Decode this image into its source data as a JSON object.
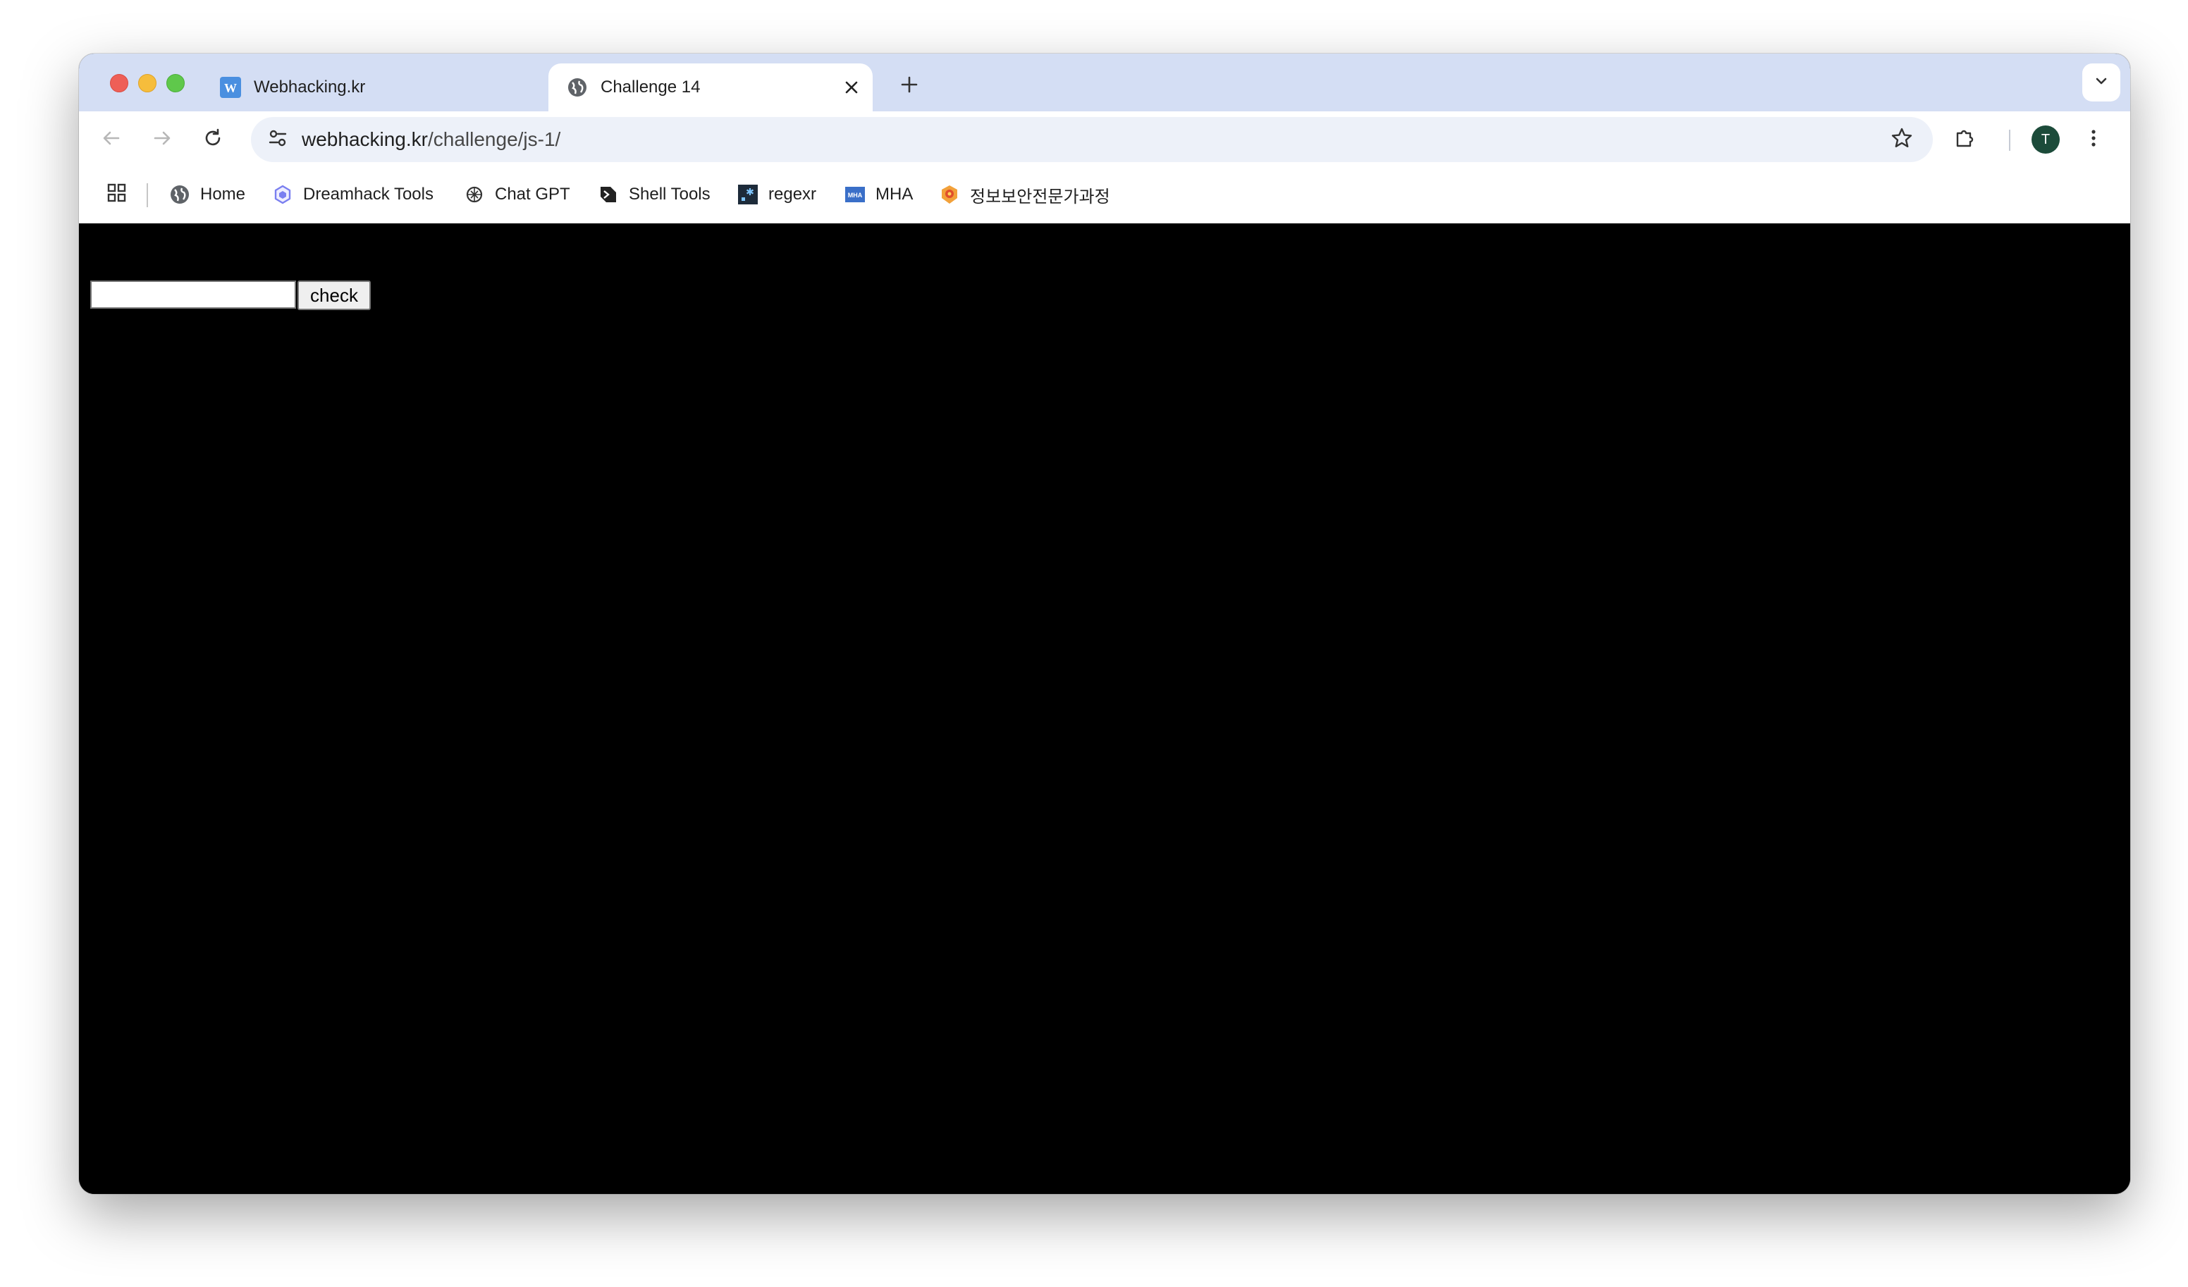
{
  "tabs": [
    {
      "title": "Webhacking.kr",
      "favicon": "webhacking-w-icon",
      "active": false
    },
    {
      "title": "Challenge 14",
      "favicon": "globe-icon",
      "active": true
    }
  ],
  "toolbar": {
    "url_host": "webhacking.kr",
    "url_path": "/challenge/js-1/",
    "profile_initial": "T"
  },
  "bookmarks": [
    {
      "label": "Home",
      "icon": "globe-icon"
    },
    {
      "label": "Dreamhack Tools",
      "icon": "dreamhack-icon"
    },
    {
      "label": "Chat GPT",
      "icon": "chatgpt-icon"
    },
    {
      "label": "Shell Tools",
      "icon": "shell-tools-icon"
    },
    {
      "label": "regexr",
      "icon": "regexr-icon"
    },
    {
      "label": "MHA",
      "icon": "mha-icon"
    },
    {
      "label": "정보보안전문가과정",
      "icon": "course-icon"
    }
  ],
  "page": {
    "input_value": "",
    "check_label": "check"
  },
  "colors": {
    "tabstrip": "#d4def4",
    "omnibox": "#edf1f9",
    "page_background": "#000000",
    "avatar": "#1c4b3a"
  }
}
